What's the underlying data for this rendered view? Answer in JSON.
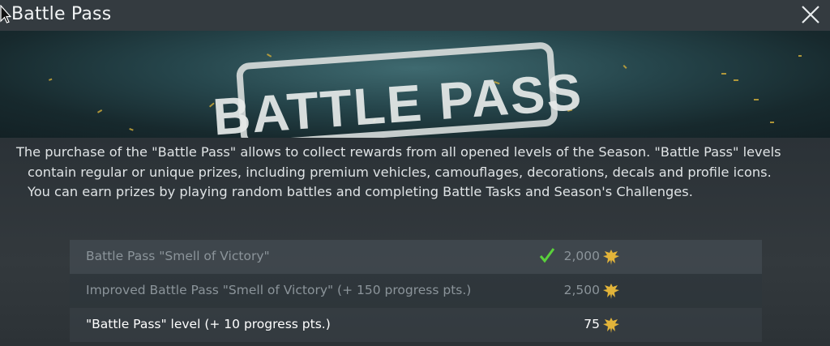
{
  "window": {
    "title": "Battle Pass",
    "close_icon": "close-icon",
    "cursor_icon": "cursor-arrow-icon"
  },
  "banner": {
    "logo_text": "BATTLE PASS"
  },
  "description": "The purchase of the \"Battle Pass\" allows to collect rewards from all opened levels of the Season. \"Battle Pass\" levels contain regular or unique prizes, including premium vehicles, camouflages, decorations, decals and profile icons. You can earn prizes by playing random battles and completing Battle Tasks and Season's Challenges.",
  "offers": [
    {
      "label": "Battle Pass \"Smell of Victory\"",
      "price": "2,000",
      "owned": true,
      "currency_icon": "golden-eagle-icon",
      "state": "muted"
    },
    {
      "label": "Improved Battle Pass \"Smell of Victory\" (+ 150 progress pts.)",
      "price": "2,500",
      "owned": false,
      "currency_icon": "golden-eagle-icon",
      "state": "muted"
    },
    {
      "label": "\"Battle Pass\" level (+ 10 progress pts.)",
      "price": "75",
      "owned": false,
      "currency_icon": "golden-eagle-icon",
      "state": "active"
    }
  ],
  "colors": {
    "owned_check": "#5ad13b",
    "currency": "#e2b43a"
  }
}
